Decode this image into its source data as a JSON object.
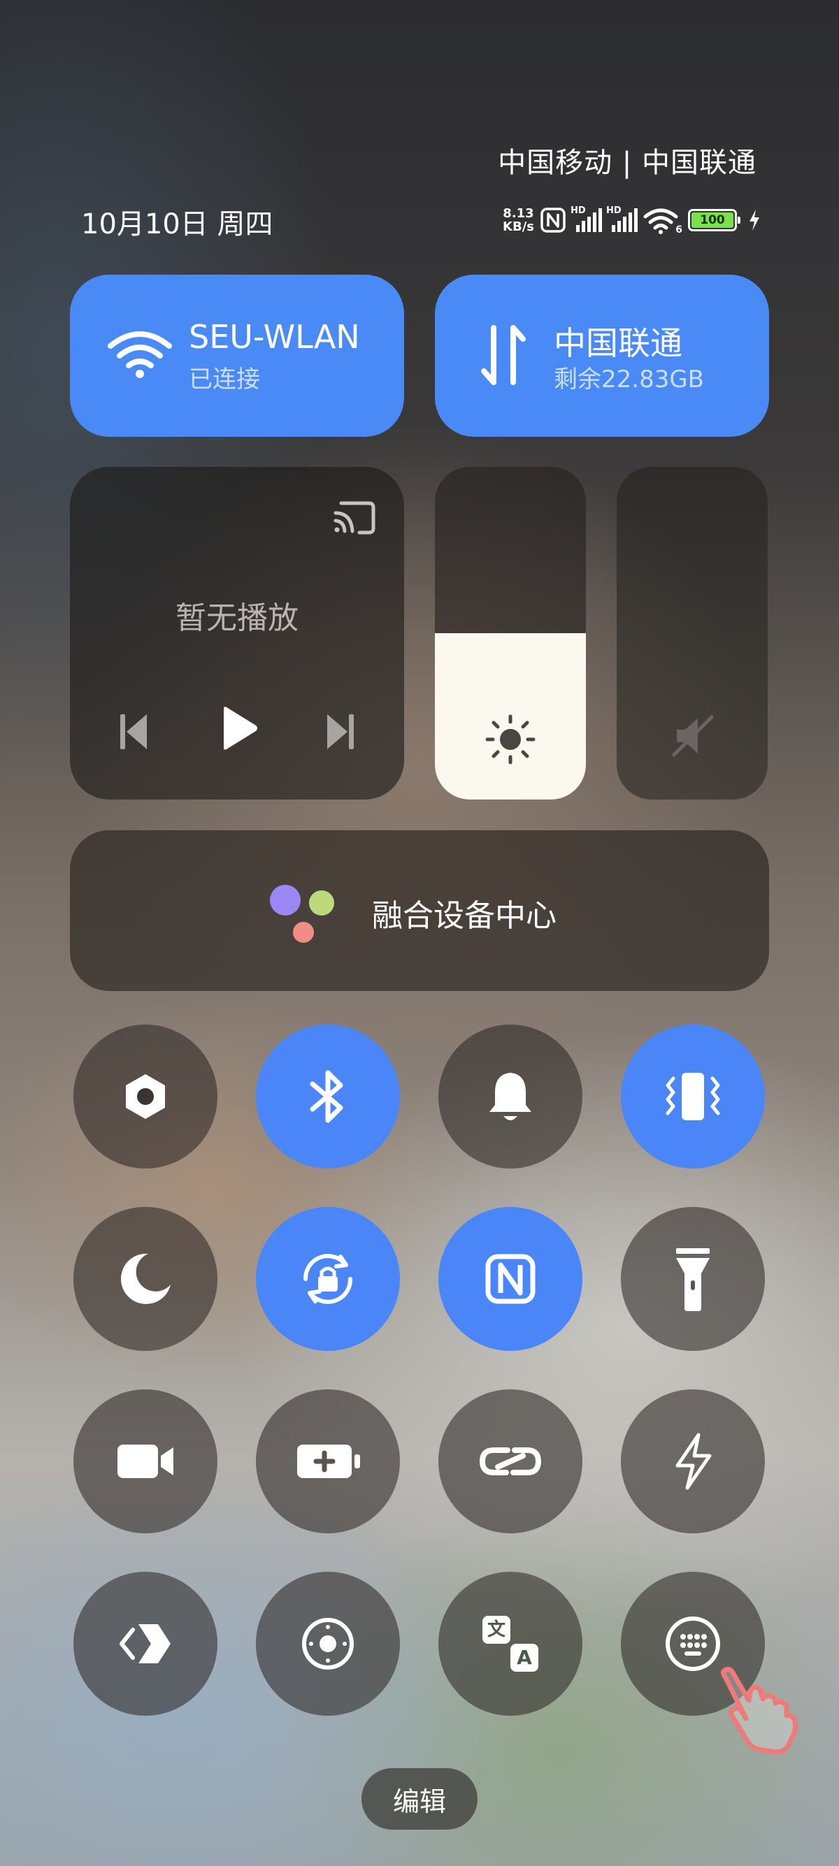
{
  "status_bar": {
    "carriers": "中国移动 | 中国联通",
    "date": "10月10日 周四",
    "net_speed_value": "8.13",
    "net_speed_unit": "KB/s",
    "signal_hd_1": "HD",
    "signal_hd_2": "HD",
    "wifi_band": "6",
    "battery_level": "100",
    "battery_color": "#7be04a"
  },
  "wifi_tile": {
    "title": "SEU-WLAN",
    "subtitle": "已连接"
  },
  "cellular_tile": {
    "title": "中国联通",
    "subtitle": "剩余22.83GB"
  },
  "media_tile": {
    "status": "暂无播放"
  },
  "brightness": {
    "level_fraction": 0.5
  },
  "device_hub": {
    "label": "融合设备中心"
  },
  "toggles": [
    {
      "name": "hexagon-setting",
      "state": "off"
    },
    {
      "name": "bluetooth",
      "state": "on"
    },
    {
      "name": "bell",
      "state": "off"
    },
    {
      "name": "vibrate",
      "state": "on"
    },
    {
      "name": "do-not-disturb",
      "state": "off"
    },
    {
      "name": "rotation-lock",
      "state": "on"
    },
    {
      "name": "nfc",
      "state": "on"
    },
    {
      "name": "flashlight",
      "state": "off"
    },
    {
      "name": "screen-record",
      "state": "off"
    },
    {
      "name": "battery-saver",
      "state": "off"
    },
    {
      "name": "link",
      "state": "off"
    },
    {
      "name": "flash",
      "state": "off"
    },
    {
      "name": "cast-arrow",
      "state": "off"
    },
    {
      "name": "target",
      "state": "off"
    },
    {
      "name": "translate",
      "state": "off"
    },
    {
      "name": "keyboard",
      "state": "off"
    }
  ],
  "translate_icon": {
    "top_char": "文",
    "bottom_char": "A"
  },
  "edit_button": {
    "label": "编辑"
  },
  "colors": {
    "accent_blue": "#4a8af6",
    "brightness_fill": "#fbf8ef",
    "pointer_hand": "#f07a7a"
  }
}
